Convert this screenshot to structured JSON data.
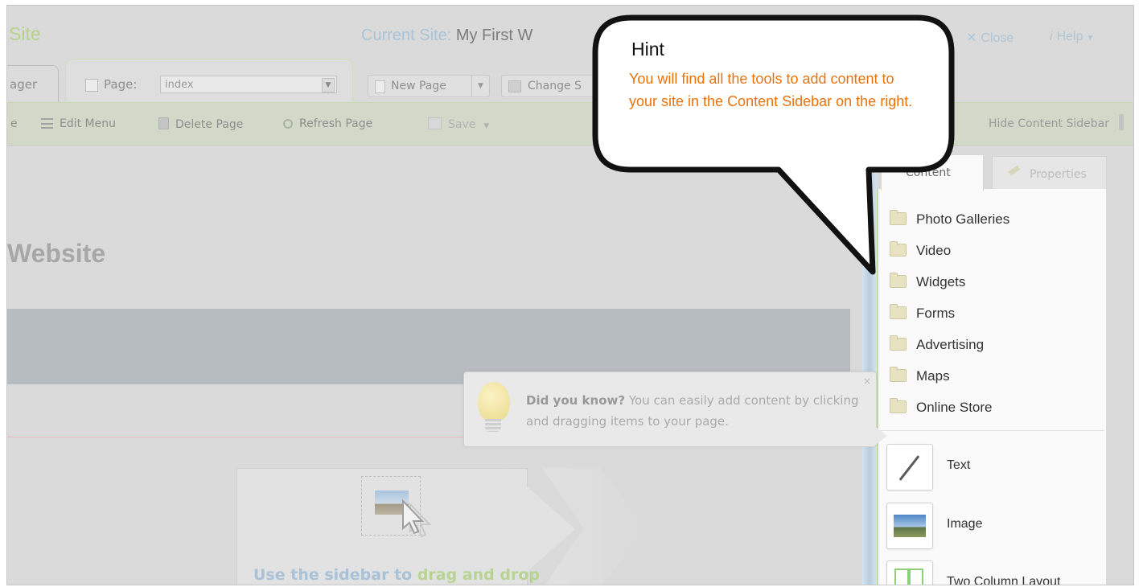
{
  "header": {
    "app_title": "Site",
    "current_site_label": "Current Site:",
    "current_site_value": "My First W",
    "close_label": "Close",
    "help_label": "Help"
  },
  "tabs": {
    "left_tab_label": "ager",
    "page_label": "Page:",
    "page_select_value": "index",
    "new_page_label": "New Page",
    "change_label": "Change S"
  },
  "toolbar": {
    "partial_left": "e",
    "edit_menu": "Edit Menu",
    "delete_page": "Delete Page",
    "refresh_page": "Refresh Page",
    "save": "Save",
    "hide_sidebar": "Hide Content Sidebar"
  },
  "main": {
    "site_title": "Website",
    "drag_text_1": "Use the sidebar to",
    "drag_text_2": "drag and drop"
  },
  "sidebar": {
    "tab_content": "Content",
    "tab_properties": "Properties",
    "folders": [
      "Photo Galleries",
      "Video",
      "Widgets",
      "Forms",
      "Advertising",
      "Maps",
      "Online Store"
    ],
    "tools": [
      {
        "label": "Text",
        "icon": "pen-icon"
      },
      {
        "label": "Image",
        "icon": "image-icon"
      },
      {
        "label": "Two Column Layout",
        "icon": "two-column-icon"
      }
    ]
  },
  "did_you_know": {
    "bold": "Did you know?",
    "text": "You can easily add content by clicking and dragging items to your page.",
    "close": "×"
  },
  "hint": {
    "title": "Hint",
    "body": "You will find all the tools to add content to your site in the Content Sidebar on the right."
  },
  "colors": {
    "hint_text": "#e8730c",
    "sidebar_border": "#c3dda7",
    "overlay_gray": "#dadada"
  }
}
